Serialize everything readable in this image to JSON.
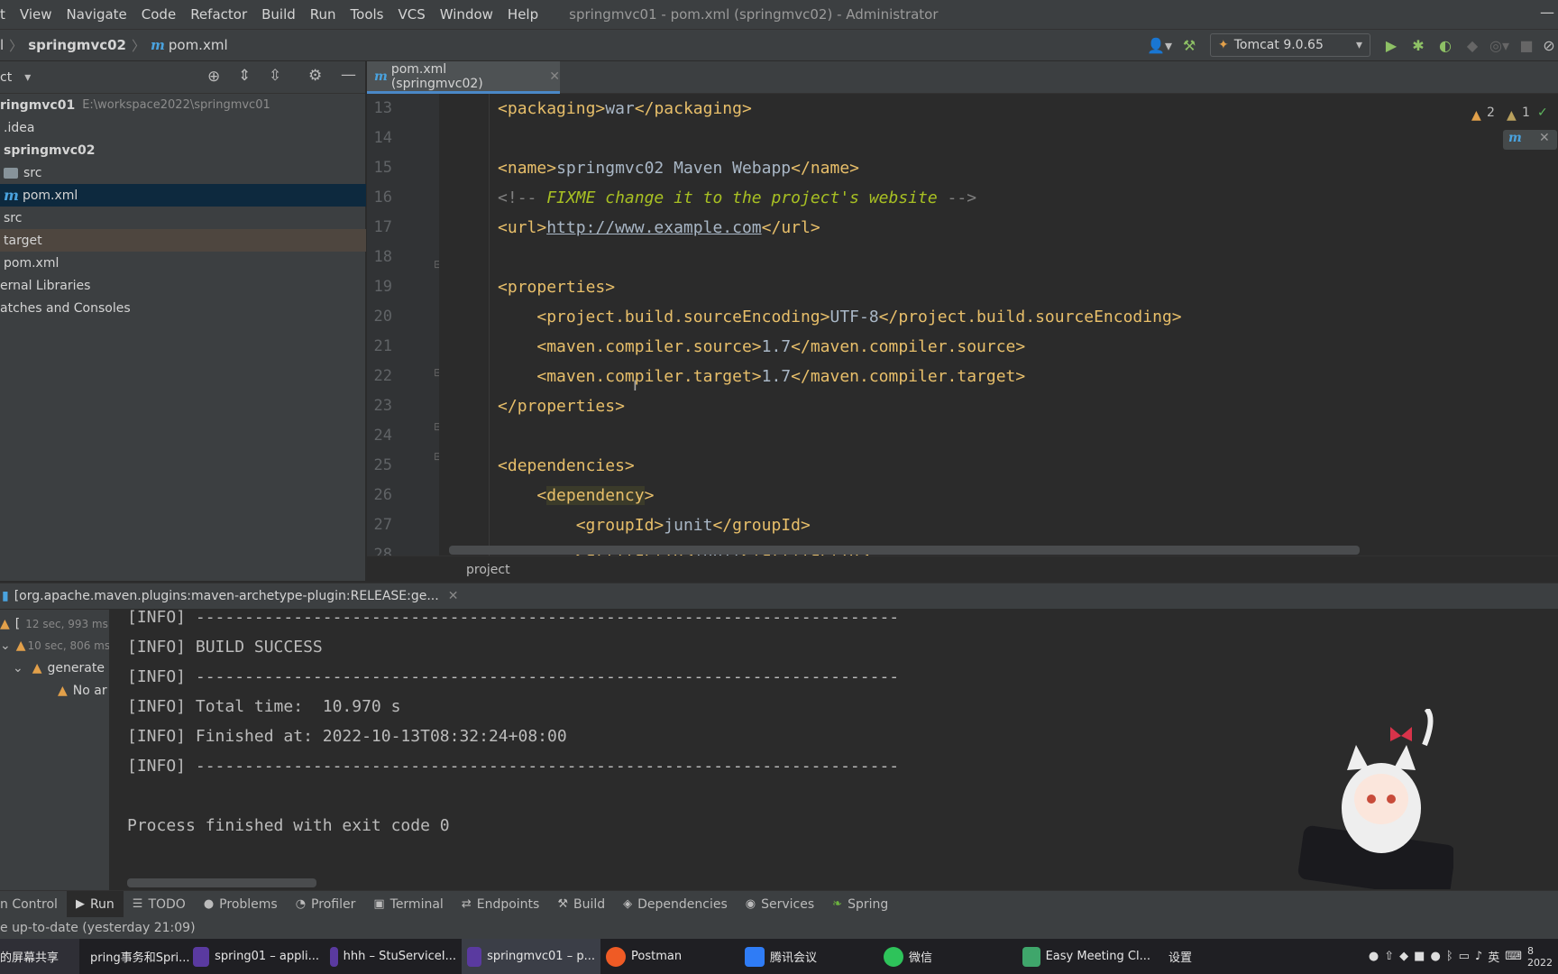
{
  "menu": [
    "t",
    "View",
    "Navigate",
    "Code",
    "Refactor",
    "Build",
    "Run",
    "Tools",
    "VCS",
    "Window",
    "Help"
  ],
  "window_title": "springmvc01 - pom.xml (springmvc02) - Administrator",
  "breadcrumb": {
    "root": "l",
    "module": "springmvc02",
    "file": "pom.xml"
  },
  "run_config": "Tomcat 9.0.65",
  "project_panel": {
    "header": "ct",
    "tree": [
      {
        "label": "ringmvc01",
        "extra": "E:\\workspace2022\\springmvc01"
      },
      {
        "label": ".idea"
      },
      {
        "label": "springmvc02"
      },
      {
        "label": "src"
      },
      {
        "label": "pom.xml"
      },
      {
        "label": "src"
      },
      {
        "label": "target"
      },
      {
        "label": "pom.xml"
      },
      {
        "label": "ernal Libraries"
      },
      {
        "label": "atches and Consoles"
      }
    ]
  },
  "editor": {
    "tab": "pom.xml (springmvc02)",
    "warnings": "2",
    "weak_warnings": "1",
    "line_numbers": [
      "13",
      "14",
      "15",
      "16",
      "17",
      "18",
      "19",
      "20",
      "21",
      "22",
      "23",
      "24",
      "25",
      "26",
      "27",
      "28"
    ],
    "breadcrumb": "project"
  },
  "run_panel": {
    "title": "[org.apache.maven.plugins:maven-archetype-plugin:RELEASE:ge...",
    "tree": [
      {
        "label": "[",
        "time": "12 sec, 993 ms"
      },
      {
        "label": "",
        "time": "10 sec, 806 ms"
      },
      {
        "label": "generate"
      },
      {
        "label": "No ar"
      }
    ],
    "console": [
      "[INFO] ------------------------------------------------------------------------",
      "[INFO] BUILD SUCCESS",
      "[INFO] ------------------------------------------------------------------------",
      "[INFO] Total time:  10.970 s",
      "[INFO] Finished at: 2022-10-13T08:32:24+08:00",
      "[INFO] ------------------------------------------------------------------------",
      "",
      "Process finished with exit code 0"
    ]
  },
  "tool_tabs": [
    "n Control",
    "Run",
    "TODO",
    "Problems",
    "Profiler",
    "Terminal",
    "Endpoints",
    "Build",
    "Dependencies",
    "Services",
    "Spring"
  ],
  "status": "e up-to-date (yesterday 21:09)",
  "taskbar": {
    "share": "的屏幕共享",
    "items": [
      "pring事务和Spri...",
      "spring01 – appli...",
      "hhh – StuServiceI...",
      "springmvc01 – p...",
      "Postman",
      "腾讯会议",
      "微信",
      "Easy Meeting Cl...",
      "设置"
    ],
    "ime": "英",
    "clock_top": "8",
    "clock_bottom": "2022"
  }
}
